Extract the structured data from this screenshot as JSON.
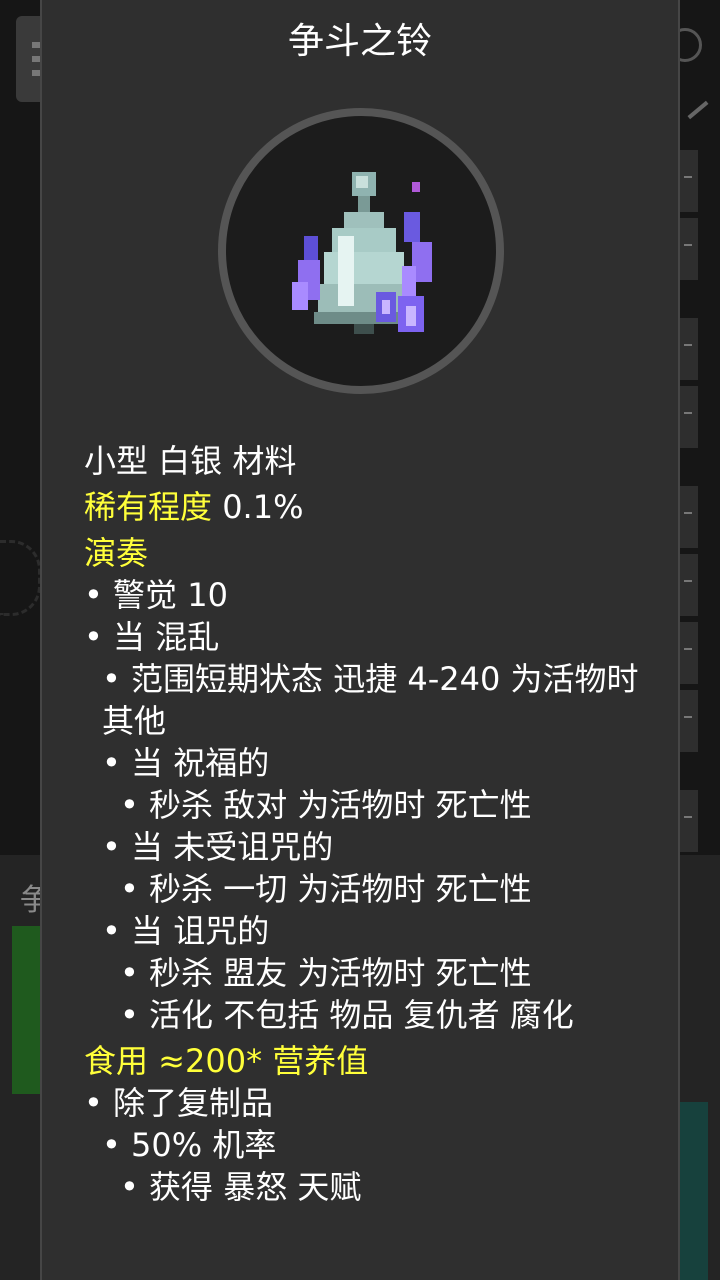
{
  "colors": {
    "dialog_bg": "#2f2f2f",
    "highlight": "#ffff3a",
    "text": "#ffffff",
    "circle_border": "#555555"
  },
  "background": {
    "left_partial_text": "争"
  },
  "dialog": {
    "title": "争斗之铃",
    "item_icon": "bell-icon",
    "descriptor": "小型 白银 材料",
    "rarity_label": "稀有程度",
    "rarity_value": "0.1%",
    "section_perform": "演奏",
    "perform_lines": [
      "• 警觉 10",
      "• 当 混乱",
      "• 范围短期状态 迅捷 4-240 为活物时",
      "其他",
      "• 当 祝福的",
      "• 秒杀 敌对 为活物时 死亡性",
      "• 当 未受诅咒的",
      "• 秒杀 一切 为活物时 死亡性",
      "• 当 诅咒的",
      "• 秒杀 盟友 为活物时 死亡性",
      "• 活化 不包括 物品 复仇者 腐化"
    ],
    "section_eat": "食用 ≈200* 营养值",
    "eat_lines": [
      "• 除了复制品",
      "• 50% 机率",
      "• 获得 暴怒 天赋"
    ]
  }
}
